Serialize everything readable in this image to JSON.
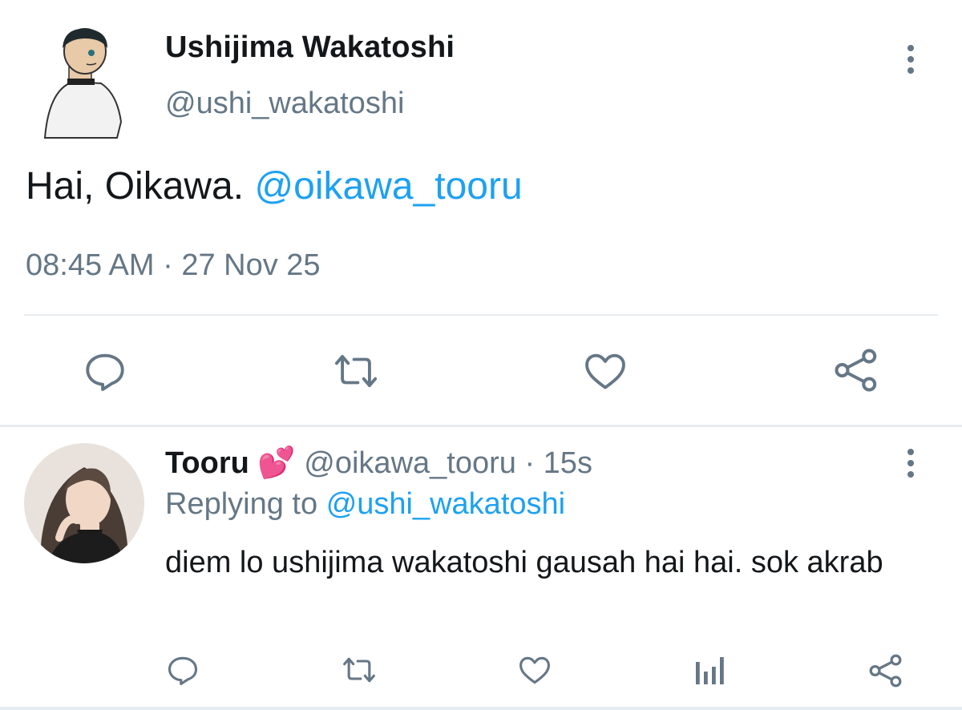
{
  "tweet": {
    "display_name": "Ushijima Wakatoshi",
    "handle": "@ushi_wakatoshi",
    "text": "Hai, Oikawa.",
    "mention": "@oikawa_tooru",
    "time": "08:45 AM",
    "dot": "·",
    "date": "27 Nov 25",
    "actions": [
      "reply-icon",
      "retweet-icon",
      "like-icon",
      "share-icon"
    ]
  },
  "reply": {
    "display_name": "Tooru",
    "emoji": "💕",
    "handle": "@oikawa_tooru",
    "dot": "·",
    "age": "15s",
    "replying_label": "Replying to",
    "replying_handle": "@ushi_wakatoshi",
    "text": "diem lo ushijima wakatoshi gausah hai hai. sok akrab",
    "actions": [
      "reply-icon",
      "retweet-icon",
      "like-icon",
      "analytics-icon",
      "share-icon"
    ]
  },
  "colors": {
    "accent": "#1da1f2",
    "muted": "#657786",
    "icon": "#657786"
  }
}
